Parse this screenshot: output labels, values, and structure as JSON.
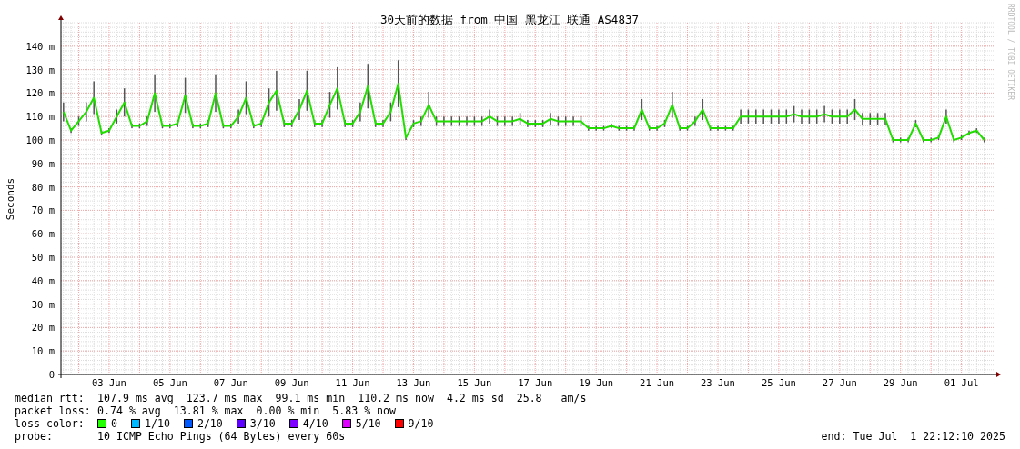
{
  "title": "30天前的数据 from 中国 黑龙江 联通 AS4837",
  "credit": "RRDTOOL / TOBI OETIKER",
  "chart_data": {
    "type": "line",
    "grid": true,
    "ylabel": "Seconds",
    "ylim": [
      0,
      150
    ],
    "yticks": [
      {
        "value": 0,
        "label": "0"
      },
      {
        "value": 10,
        "label": "10 m"
      },
      {
        "value": 20,
        "label": "20 m"
      },
      {
        "value": 30,
        "label": "30 m"
      },
      {
        "value": 40,
        "label": "40 m"
      },
      {
        "value": 50,
        "label": "50 m"
      },
      {
        "value": 60,
        "label": "60 m"
      },
      {
        "value": 70,
        "label": "70 m"
      },
      {
        "value": 80,
        "label": "80 m"
      },
      {
        "value": 90,
        "label": "90 m"
      },
      {
        "value": 100,
        "label": "100 m"
      },
      {
        "value": 110,
        "label": "110 m"
      },
      {
        "value": 120,
        "label": "120 m"
      },
      {
        "value": 130,
        "label": "130 m"
      },
      {
        "value": 140,
        "label": "140 m"
      }
    ],
    "categories": [
      null,
      null,
      null,
      null,
      null,
      null,
      "03 Jun",
      null,
      null,
      null,
      null,
      null,
      null,
      null,
      "05 Jun",
      null,
      null,
      null,
      null,
      null,
      null,
      null,
      "07 Jun",
      null,
      null,
      null,
      null,
      null,
      null,
      null,
      "09 Jun",
      null,
      null,
      null,
      null,
      null,
      null,
      null,
      "11 Jun",
      null,
      null,
      null,
      null,
      null,
      null,
      null,
      "13 Jun",
      null,
      null,
      null,
      null,
      null,
      null,
      null,
      "15 Jun",
      null,
      null,
      null,
      null,
      null,
      null,
      null,
      "17 Jun",
      null,
      null,
      null,
      null,
      null,
      null,
      null,
      "19 Jun",
      null,
      null,
      null,
      null,
      null,
      null,
      null,
      "21 Jun",
      null,
      null,
      null,
      null,
      null,
      null,
      null,
      "23 Jun",
      null,
      null,
      null,
      null,
      null,
      null,
      null,
      "25 Jun",
      null,
      null,
      null,
      null,
      null,
      null,
      null,
      "27 Jun",
      null,
      null,
      null,
      null,
      null,
      null,
      null,
      "29 Jun",
      null,
      null,
      null,
      null,
      null,
      null,
      null,
      "01 Jul",
      null,
      null,
      null
    ],
    "series": [
      {
        "color": "#22dd00",
        "errors": [
          4,
          1,
          2,
          4,
          7,
          1,
          1,
          3,
          6,
          1,
          1,
          2,
          8,
          1,
          1,
          1.5,
          7.5,
          1,
          1,
          1.5,
          8,
          1,
          1,
          3,
          7,
          1,
          1.5,
          6,
          8.5,
          1.5,
          1.5,
          4.5,
          8.5,
          1.5,
          1.5,
          5.5,
          9,
          1.5,
          1.5,
          4,
          9.5,
          1.5,
          1.5,
          4,
          10,
          1,
          1.5,
          2,
          5.5,
          2,
          2,
          2,
          2,
          2,
          2,
          2,
          3,
          2,
          2,
          2,
          2.5,
          1.5,
          1.5,
          1.5,
          2.5,
          2,
          2,
          2,
          2,
          1,
          1,
          1,
          1,
          1,
          1,
          1,
          4.5,
          1,
          1,
          1.5,
          5.5,
          1,
          1,
          2,
          4.5,
          1,
          1,
          1,
          1,
          3,
          3,
          3,
          3,
          3,
          3,
          3,
          3.5,
          3,
          3,
          3,
          3.5,
          3,
          3,
          3,
          4.5,
          2.5,
          2.5,
          2.5,
          2.5,
          1,
          1,
          1,
          1.5,
          1,
          1,
          1,
          3,
          1,
          1,
          1,
          1,
          1
        ],
        "values": [
          112,
          104,
          108,
          112,
          118,
          103,
          104,
          110,
          116,
          106,
          106,
          108,
          120,
          106,
          106,
          107,
          119,
          106,
          106,
          107,
          120,
          106,
          106,
          110,
          118,
          106,
          107,
          116,
          121,
          107,
          107,
          113,
          121,
          107,
          107,
          115,
          122,
          107,
          107,
          112,
          123,
          107,
          107,
          112,
          124,
          101,
          107,
          108,
          115,
          108,
          108,
          108,
          108,
          108,
          108,
          108,
          110,
          108,
          108,
          108,
          109,
          107,
          107,
          107,
          109,
          108,
          108,
          108,
          108,
          105,
          105,
          105,
          106,
          105,
          105,
          105,
          113,
          105,
          105,
          107,
          115,
          105,
          105,
          108,
          113,
          105,
          105,
          105,
          105,
          110,
          110,
          110,
          110,
          110,
          110,
          110,
          111,
          110,
          110,
          110,
          111,
          110,
          110,
          110,
          113,
          109,
          109,
          109,
          109,
          100,
          100,
          100,
          107,
          100,
          100,
          101,
          110,
          100,
          101,
          103,
          104,
          100
        ]
      }
    ]
  },
  "stats": [
    {
      "label": "median rtt:",
      "text": "107.9 ms avg  123.7 ms max  99.1 ms min  110.2 ms now  4.2 ms sd  25.8   am/s"
    },
    {
      "label": "packet loss:",
      "text": "0.74 % avg  13.81 % max  0.00 % min  5.83 % now"
    }
  ],
  "loss_legend": {
    "label": "loss color:",
    "items": [
      {
        "label": "0",
        "color": "#22ff00"
      },
      {
        "label": "1/10",
        "color": "#00b8ff"
      },
      {
        "label": "2/10",
        "color": "#0059ff"
      },
      {
        "label": "3/10",
        "color": "#5e00ff"
      },
      {
        "label": "4/10",
        "color": "#7e00ff"
      },
      {
        "label": "5/10",
        "color": "#dd00ff"
      },
      {
        "label": "9/10",
        "color": "#ff0000"
      }
    ]
  },
  "probe": {
    "label": "probe:",
    "text": "10 ICMP Echo Pings (64 Bytes) every 60s"
  },
  "end": "end: Tue Jul  1 22:12:10 2025"
}
